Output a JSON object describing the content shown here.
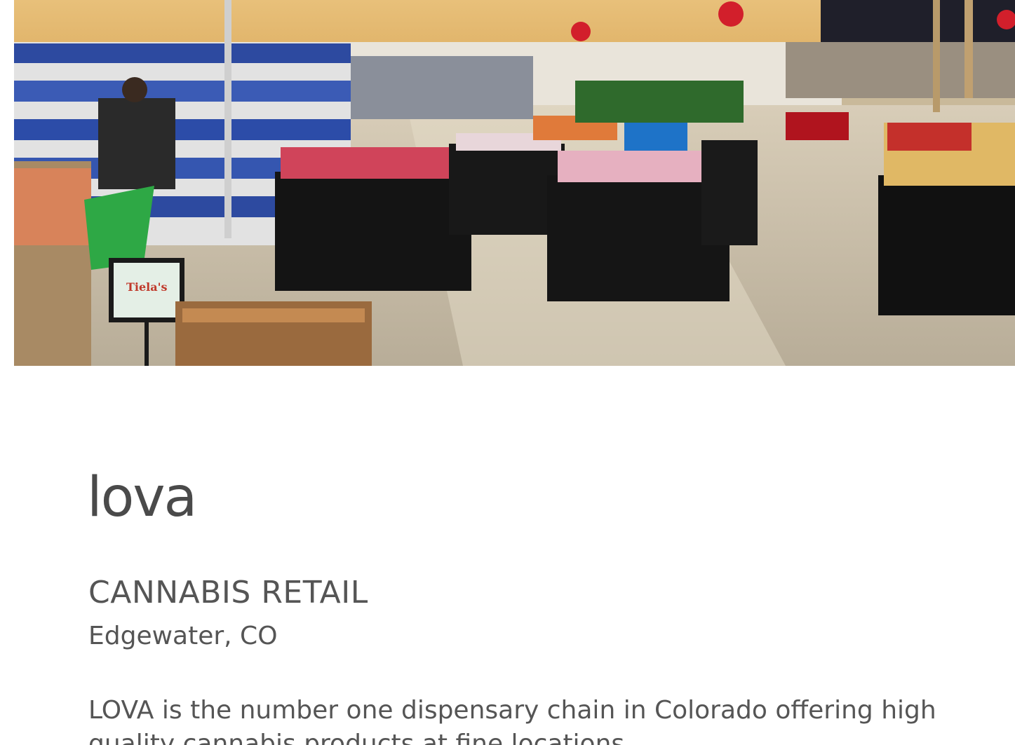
{
  "company": {
    "name": "lova",
    "category": "CANNABIS RETAIL",
    "location": "Edgewater, CO",
    "description": "LOVA is the number one dispensary chain in Colorado offering high quality cannabis products at fine locations."
  },
  "hero": {
    "subject": "store interior",
    "sign_text": "Tiela's"
  },
  "colors": {
    "heading": "#4a4a4a",
    "body_text": "#555555",
    "background": "#ffffff"
  }
}
